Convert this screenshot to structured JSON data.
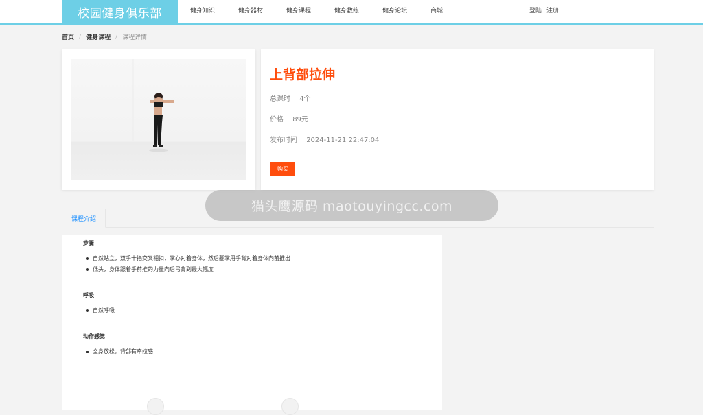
{
  "header": {
    "logo": "校园健身俱乐部",
    "nav": [
      "健身知识",
      "健身器材",
      "健身课程",
      "健身教练",
      "健身论坛",
      "商城"
    ],
    "login": "登陆",
    "register": "注册"
  },
  "breadcrumb": {
    "home": "首页",
    "section": "健身课程",
    "current": "课程详情",
    "separator": "/"
  },
  "course": {
    "title": "上背部拉伸",
    "lessons_label": "总课时",
    "lessons_value": "4个",
    "price_label": "价格",
    "price_value": "89元",
    "publish_label": "发布时间",
    "publish_value": "2024-11-21 22:47:04",
    "buy_label": "购买"
  },
  "watermark": "猫头鹰源码 maotouyingcc.com",
  "tabs": [
    "课程介绍"
  ],
  "intro": {
    "steps_title": "步骤",
    "steps": [
      "自然站立，双手十指交叉相扣，掌心对着身体，然后翻掌用手背对着身体向前推出",
      "低头，身体跟着手前推的力量向后弓背到最大幅度"
    ],
    "breath_title": "呼吸",
    "breath": [
      "自然呼吸"
    ],
    "feel_title": "动作感觉",
    "feel": [
      "全身放松，背部有牵拉感"
    ]
  },
  "colors": {
    "accent": "#6dcfe6",
    "primary": "#ff4d0d",
    "link": "#1e90ff"
  }
}
